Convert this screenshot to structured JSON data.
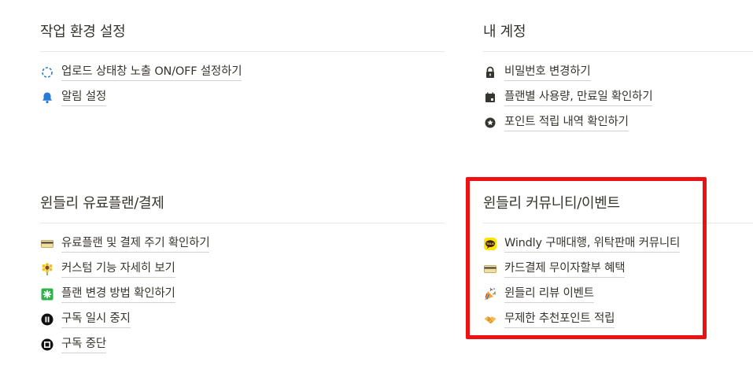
{
  "sections": {
    "workspace": {
      "title": "작업 환경 설정",
      "items": [
        {
          "label": "업로드 상태창 노출 ON/OFF 설정하기",
          "icon": "dashed-circle-icon"
        },
        {
          "label": "알림 설정",
          "icon": "bell-icon"
        }
      ]
    },
    "account": {
      "title": "내 계정",
      "items": [
        {
          "label": "비밀번호 변경하기",
          "icon": "lock-icon"
        },
        {
          "label": "플랜별 사용량, 만료일 확인하기",
          "icon": "calendar-icon"
        },
        {
          "label": "포인트 적립 내역 확인하기",
          "icon": "star-badge-icon"
        }
      ]
    },
    "billing": {
      "title": "윈들리 유료플랜/결제",
      "items": [
        {
          "label": "유료플랜 및 결제 주기 확인하기",
          "icon": "credit-card-icon"
        },
        {
          "label": "커스텀 기능 자세히 보기",
          "icon": "sunflower-icon"
        },
        {
          "label": "플랜 변경 방법 확인하기",
          "icon": "sparkle-box-icon"
        },
        {
          "label": "구독 일시 중지",
          "icon": "pause-icon"
        },
        {
          "label": "구독 중단",
          "icon": "stop-icon"
        }
      ]
    },
    "community": {
      "title": "윈들리 커뮤니티/이벤트",
      "items": [
        {
          "label": "Windly 구매대행, 위탁판매 커뮤니티",
          "icon": "kakaotalk-icon"
        },
        {
          "label": "카드결제 무이자할부 혜택",
          "icon": "credit-card-icon"
        },
        {
          "label": "윈들리 리뷰 이벤트",
          "icon": "party-popper-icon"
        },
        {
          "label": "무제한 추천포인트 적립",
          "icon": "handshake-icon"
        }
      ]
    }
  },
  "kakao_badge_text": "TALK",
  "colors": {
    "highlight": "#ee1111",
    "text": "#37352f",
    "divider": "#e6e6e4",
    "accent_blue": "#2a7bd4"
  }
}
